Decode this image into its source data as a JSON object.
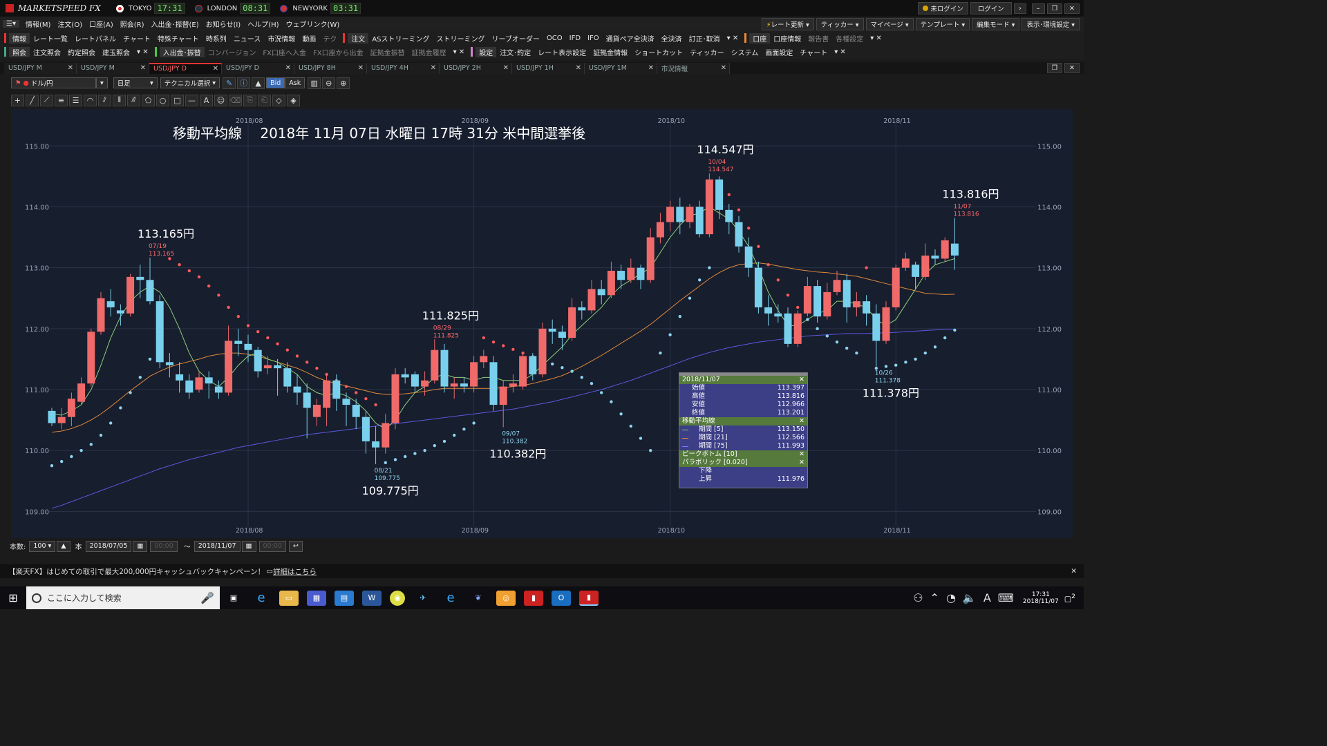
{
  "app": {
    "logo_text": "MARKETSPEED FX",
    "clocks": [
      {
        "city": "TOKYO",
        "time": "17:31",
        "color": "#d11"
      },
      {
        "city": "LONDON",
        "time": "08:31",
        "color": "#345"
      },
      {
        "city": "NEWYORK",
        "time": "03:31",
        "color": "#246"
      }
    ],
    "login_status": "未ログイン",
    "login_button": "ログイン"
  },
  "menu": [
    "情報(M)",
    "注文(O)",
    "口座(A)",
    "照会(R)",
    "入出金･振替(E)",
    "お知らせ(I)",
    "ヘルプ(H)",
    "ウェブリンク(W)"
  ],
  "toolbar1": {
    "group_info": "情報",
    "info_items": [
      "レート一覧",
      "レートパネル",
      "チャート",
      "特殊チャート",
      "時系列",
      "ニュース",
      "市況情報",
      "動画",
      "テク"
    ],
    "group_order": "注文",
    "order_items": [
      "ASストリーミング",
      "ストリーミング",
      "リーブオーダー",
      "OCO",
      "IFD",
      "IFO",
      "通貨ペア全決済",
      "全決済",
      "訂正･取消"
    ],
    "group_account": "口座",
    "account_items": [
      "口座情報",
      "報告書",
      "各種設定"
    ]
  },
  "toolbar_right": [
    "レート更新",
    "ティッカー",
    "マイページ",
    "テンプレート",
    "編集モード",
    "表示･環境設定"
  ],
  "toolbar2": {
    "group_query": "照会",
    "query_items": [
      "注文照会",
      "約定照会",
      "建玉照会"
    ],
    "group_fund": "入出金･振替",
    "fund_items": [
      "コンバージョン",
      "FX口座へ入金",
      "FX口座から出金",
      "証拠金振替",
      "証拠金履歴"
    ],
    "group_settings": "設定",
    "settings_items": [
      "注文･約定",
      "レート表示設定",
      "証拠金情報",
      "ショートカット",
      "ティッカー",
      "システム",
      "画面設定",
      "チャート"
    ]
  },
  "tabs": [
    "USD/JPY M",
    "USD/JPY M",
    "USD/JPY D",
    "USD/JPY D",
    "USD/JPY 8H",
    "USD/JPY 4H",
    "USD/JPY 2H",
    "USD/JPY 1H",
    "USD/JPY 1M",
    "市況情報"
  ],
  "active_tab": 2,
  "controls": {
    "currency": "ドル/円",
    "period": "日足",
    "technical": "テクニカル選択",
    "bid": "Bid",
    "ask": "Ask"
  },
  "chart_title": "移動平均線　 2018年 11月 07日 水曜日 17時 31分 米中間選挙後",
  "chart_data": {
    "type": "candlestick",
    "y_range": [
      108.8,
      115.4
    ],
    "y_ticks": [
      "115.00",
      "114.00",
      "113.00",
      "112.00",
      "111.00",
      "110.00",
      "109.00"
    ],
    "x_month_labels": [
      {
        "label": "2018/08",
        "index": 20
      },
      {
        "label": "2018/09",
        "index": 43
      },
      {
        "label": "2018/10",
        "index": 63
      },
      {
        "label": "2018/11",
        "index": 86
      }
    ],
    "candles": [
      [
        110.65,
        110.45,
        110.7,
        110.4
      ],
      [
        110.45,
        110.55,
        110.7,
        110.35
      ],
      [
        110.55,
        110.85,
        110.95,
        110.4
      ],
      [
        110.8,
        111.1,
        111.2,
        110.75
      ],
      [
        111.1,
        111.95,
        112.0,
        111.05
      ],
      [
        111.95,
        112.5,
        112.6,
        111.9
      ],
      [
        112.45,
        112.35,
        112.65,
        112.2
      ],
      [
        112.3,
        112.25,
        112.4,
        112.05
      ],
      [
        112.25,
        112.85,
        112.9,
        112.2
      ],
      [
        112.85,
        112.8,
        113.05,
        112.5
      ],
      [
        112.8,
        112.45,
        113.165,
        112.4
      ],
      [
        112.45,
        111.45,
        112.55,
        111.35
      ],
      [
        111.45,
        111.4,
        111.6,
        111.2
      ],
      [
        111.25,
        111.15,
        111.45,
        110.95
      ],
      [
        111.15,
        110.95,
        111.25,
        110.85
      ],
      [
        111.0,
        111.2,
        111.3,
        110.95
      ],
      [
        111.2,
        111.1,
        111.3,
        110.85
      ],
      [
        111.05,
        110.95,
        111.15,
        110.85
      ],
      [
        110.95,
        111.8,
        112.05,
        110.9
      ],
      [
        111.8,
        111.75,
        112.0,
        111.55
      ],
      [
        111.75,
        111.65,
        111.9,
        111.45
      ],
      [
        111.65,
        111.3,
        111.7,
        111.2
      ],
      [
        111.35,
        111.4,
        111.55,
        111.25
      ],
      [
        111.4,
        111.35,
        111.5,
        110.9
      ],
      [
        111.35,
        111.05,
        111.45,
        110.95
      ],
      [
        111.05,
        110.95,
        111.25,
        110.75
      ],
      [
        110.95,
        110.7,
        111.1,
        110.2
      ],
      [
        110.55,
        110.75,
        110.85,
        110.4
      ],
      [
        110.7,
        111.15,
        111.25,
        110.4
      ],
      [
        111.15,
        110.85,
        111.25,
        110.65
      ],
      [
        110.85,
        110.75,
        110.95,
        110.4
      ],
      [
        110.75,
        110.55,
        110.85,
        110.35
      ],
      [
        110.55,
        110.15,
        110.65,
        109.95
      ],
      [
        110.15,
        110.05,
        110.4,
        109.775
      ],
      [
        110.05,
        110.45,
        110.6,
        109.95
      ],
      [
        110.45,
        111.25,
        111.35,
        110.35
      ],
      [
        111.25,
        111.2,
        111.35,
        111.1
      ],
      [
        111.25,
        111.05,
        111.3,
        110.95
      ],
      [
        111.05,
        111.15,
        111.3,
        110.9
      ],
      [
        111.15,
        111.65,
        111.825,
        111.1
      ],
      [
        111.65,
        111.05,
        111.75,
        110.95
      ],
      [
        111.05,
        111.1,
        111.2,
        110.85
      ],
      [
        111.1,
        111.05,
        111.2,
        110.95
      ],
      [
        111.05,
        111.45,
        111.55,
        110.95
      ],
      [
        111.45,
        111.55,
        111.65,
        111.35
      ],
      [
        111.45,
        110.75,
        111.55,
        110.65
      ],
      [
        110.75,
        111.05,
        111.15,
        110.382
      ],
      [
        111.05,
        111.1,
        111.25,
        110.95
      ],
      [
        111.05,
        111.55,
        111.6,
        111.0
      ],
      [
        111.55,
        111.25,
        111.6,
        111.15
      ],
      [
        111.25,
        112.0,
        112.1,
        111.2
      ],
      [
        112.0,
        111.95,
        112.15,
        111.75
      ],
      [
        111.95,
        111.85,
        112.05,
        111.65
      ],
      [
        111.85,
        112.35,
        112.5,
        111.8
      ],
      [
        112.35,
        112.3,
        112.45,
        112.15
      ],
      [
        112.3,
        112.65,
        112.8,
        112.25
      ],
      [
        112.65,
        112.55,
        112.8,
        112.4
      ],
      [
        112.55,
        112.95,
        113.1,
        112.5
      ],
      [
        112.95,
        112.8,
        113.05,
        112.65
      ],
      [
        112.8,
        113.0,
        113.15,
        112.75
      ],
      [
        113.0,
        112.8,
        113.05,
        112.65
      ],
      [
        112.8,
        113.5,
        113.65,
        112.75
      ],
      [
        113.5,
        113.75,
        113.9,
        113.4
      ],
      [
        113.75,
        114.0,
        114.1,
        113.6
      ],
      [
        114.0,
        113.75,
        114.15,
        113.55
      ],
      [
        113.75,
        114.0,
        114.05,
        113.65
      ],
      [
        114.0,
        113.55,
        114.1,
        113.5
      ],
      [
        113.55,
        114.45,
        114.547,
        113.5
      ],
      [
        114.45,
        113.95,
        114.5,
        113.8
      ],
      [
        113.95,
        113.75,
        114.05,
        113.55
      ],
      [
        113.75,
        113.35,
        113.85,
        113.25
      ],
      [
        113.35,
        113.0,
        113.5,
        112.85
      ],
      [
        113.0,
        112.35,
        113.1,
        112.25
      ],
      [
        112.35,
        112.25,
        112.55,
        112.05
      ],
      [
        112.25,
        112.2,
        112.4,
        112.1
      ],
      [
        112.25,
        111.75,
        112.35,
        111.7
      ],
      [
        111.75,
        112.25,
        112.3,
        111.7
      ],
      [
        112.25,
        112.7,
        112.85,
        112.2
      ],
      [
        112.7,
        112.2,
        112.8,
        112.1
      ],
      [
        112.2,
        112.6,
        112.75,
        112.15
      ],
      [
        112.6,
        112.8,
        112.95,
        112.55
      ],
      [
        112.8,
        112.35,
        112.9,
        112.1
      ],
      [
        112.35,
        112.45,
        112.6,
        112.2
      ],
      [
        112.45,
        112.25,
        112.55,
        112.05
      ],
      [
        112.25,
        111.8,
        112.4,
        111.378
      ],
      [
        111.8,
        112.35,
        112.45,
        111.75
      ],
      [
        112.35,
        113.0,
        113.05,
        112.3
      ],
      [
        113.0,
        113.15,
        113.25,
        112.95
      ],
      [
        113.05,
        112.85,
        113.1,
        112.65
      ],
      [
        112.85,
        113.2,
        113.4,
        112.8
      ],
      [
        113.2,
        113.15,
        113.3,
        113.05
      ],
      [
        113.15,
        113.45,
        113.5,
        113.1
      ],
      [
        113.397,
        113.201,
        113.816,
        112.966
      ]
    ],
    "ma5": [
      110.6,
      110.58,
      110.65,
      110.75,
      111.0,
      111.4,
      111.85,
      112.2,
      112.45,
      112.6,
      112.7,
      112.6,
      112.35,
      112.0,
      111.6,
      111.3,
      111.15,
      111.05,
      111.2,
      111.4,
      111.55,
      111.6,
      111.5,
      111.45,
      111.35,
      111.25,
      111.05,
      110.95,
      110.9,
      110.95,
      110.9,
      110.8,
      110.65,
      110.45,
      110.35,
      110.5,
      110.75,
      110.95,
      111.05,
      111.2,
      111.25,
      111.2,
      111.2,
      111.15,
      111.2,
      111.2,
      111.15,
      111.15,
      111.15,
      111.25,
      111.4,
      111.55,
      111.7,
      111.9,
      112.05,
      112.2,
      112.35,
      112.55,
      112.7,
      112.8,
      112.9,
      113.0,
      113.25,
      113.5,
      113.7,
      113.85,
      113.9,
      114.0,
      113.9,
      113.8,
      113.6,
      113.35,
      113.0,
      112.6,
      112.3,
      112.05,
      112.05,
      112.15,
      112.25,
      112.3,
      112.45,
      112.45,
      112.4,
      112.35,
      112.15,
      112.05,
      112.15,
      112.4,
      112.65,
      112.9,
      113.05,
      113.1,
      113.15
    ],
    "ma21": [
      110.3,
      110.32,
      110.36,
      110.42,
      110.5,
      110.6,
      110.72,
      110.85,
      110.98,
      111.1,
      111.22,
      111.3,
      111.37,
      111.42,
      111.46,
      111.5,
      111.55,
      111.58,
      111.6,
      111.6,
      111.58,
      111.55,
      111.5,
      111.45,
      111.4,
      111.35,
      111.28,
      111.2,
      111.14,
      111.1,
      111.06,
      111.02,
      110.98,
      110.94,
      110.92,
      110.92,
      110.93,
      110.95,
      110.97,
      111.0,
      111.02,
      111.02,
      111.02,
      111.02,
      111.02,
      111.02,
      111.03,
      111.05,
      111.07,
      111.1,
      111.14,
      111.18,
      111.23,
      111.3,
      111.38,
      111.47,
      111.56,
      111.66,
      111.76,
      111.86,
      111.96,
      112.07,
      112.2,
      112.33,
      112.46,
      112.58,
      112.7,
      112.82,
      112.92,
      113.0,
      113.05,
      113.07,
      113.08,
      113.06,
      113.03,
      113.0,
      112.97,
      112.95,
      112.93,
      112.92,
      112.9,
      112.88,
      112.86,
      112.82,
      112.78,
      112.74,
      112.7,
      112.66,
      112.62,
      112.58,
      112.57,
      112.56,
      112.566
    ],
    "ma75": [
      109.05,
      109.1,
      109.16,
      109.22,
      109.28,
      109.34,
      109.4,
      109.46,
      109.52,
      109.58,
      109.64,
      109.7,
      109.75,
      109.8,
      109.85,
      109.89,
      109.93,
      109.97,
      110.01,
      110.05,
      110.08,
      110.11,
      110.14,
      110.17,
      110.2,
      110.23,
      110.26,
      110.28,
      110.3,
      110.32,
      110.34,
      110.36,
      110.38,
      110.4,
      110.42,
      110.44,
      110.46,
      110.48,
      110.5,
      110.52,
      110.54,
      110.56,
      110.58,
      110.6,
      110.62,
      110.64,
      110.66,
      110.68,
      110.71,
      110.74,
      110.77,
      110.8,
      110.84,
      110.88,
      110.92,
      110.96,
      111.0,
      111.05,
      111.1,
      111.15,
      111.21,
      111.27,
      111.33,
      111.39,
      111.45,
      111.51,
      111.56,
      111.61,
      111.65,
      111.69,
      111.72,
      111.75,
      111.78,
      111.8,
      111.82,
      111.84,
      111.86,
      111.88,
      111.89,
      111.9,
      111.91,
      111.92,
      111.92,
      111.92,
      111.93,
      111.93,
      111.94,
      111.95,
      111.96,
      111.97,
      111.98,
      111.99,
      111.993
    ],
    "sar": [
      109.75,
      109.82,
      109.9,
      110.0,
      110.1,
      110.25,
      110.45,
      110.7,
      110.95,
      111.2,
      111.5,
      111.8,
      113.15,
      113.05,
      112.95,
      112.85,
      112.7,
      112.55,
      112.35,
      112.2,
      112.05,
      111.95,
      111.85,
      111.75,
      111.65,
      111.55,
      111.45,
      111.35,
      111.25,
      111.15,
      111.05,
      110.95,
      110.85,
      110.75,
      109.8,
      109.85,
      109.9,
      109.95,
      110.0,
      110.08,
      110.15,
      110.25,
      110.35,
      110.45,
      111.85,
      111.78,
      111.72,
      111.66,
      111.6,
      111.54,
      111.48,
      111.42,
      111.36,
      111.3,
      111.2,
      111.1,
      110.95,
      110.8,
      110.6,
      110.4,
      110.2,
      110.0,
      111.6,
      111.9,
      112.2,
      112.5,
      112.8,
      113.0,
      114.4,
      114.2,
      113.95,
      113.65,
      113.35,
      113.05,
      112.8,
      112.55,
      112.35,
      112.15,
      112.0,
      111.88,
      111.78,
      111.68,
      111.6,
      113.0,
      111.35,
      111.38,
      111.4,
      111.45,
      111.5,
      111.6,
      111.7,
      111.85,
      111.976
    ],
    "peaks": [
      {
        "index": 10,
        "date": "07/19",
        "value": "113.165",
        "big": "113.165円",
        "pos": "top"
      },
      {
        "index": 33,
        "date": "08/21",
        "value": "109.775",
        "big": "109.775円",
        "pos": "bottom"
      },
      {
        "index": 39,
        "date": "08/29",
        "value": "111.825",
        "big": "111.825円",
        "pos": "top"
      },
      {
        "index": 46,
        "date": "09/07",
        "value": "110.382",
        "big": "110.382円",
        "pos": "bottom"
      },
      {
        "index": 67,
        "date": "10/04",
        "value": "114.547",
        "big": "114.547円",
        "pos": "top"
      },
      {
        "index": 84,
        "date": "10/26",
        "value": "111.378",
        "big": "111.378円",
        "pos": "bottom"
      },
      {
        "index": 92,
        "date": "11/07",
        "value": "113.816",
        "big": "113.816円",
        "pos": "top"
      }
    ],
    "colors": {
      "up": "#f06a6a",
      "down": "#79d0ec",
      "ma5": "#8fd07a",
      "ma21": "#e08a3a",
      "ma75": "#5a5ae0",
      "sar": "#ff5a5a",
      "sar_up": "#8fd4f0"
    }
  },
  "popup": {
    "date": "2018/11/07",
    "ohlc": [
      [
        "始値",
        "113.397"
      ],
      [
        "高値",
        "113.816"
      ],
      [
        "安値",
        "112.966"
      ],
      [
        "終値",
        "113.201"
      ]
    ],
    "ma_title": "移動平均線",
    "ma": [
      [
        "期間 [5]",
        "113.150"
      ],
      [
        "期間 [21]",
        "112.566"
      ],
      [
        "期間 [75]",
        "111.993"
      ]
    ],
    "peak_title": "ピークボトム [10]",
    "sar_title": "パラボリック [0.020]",
    "sar": [
      [
        "下降",
        ""
      ],
      [
        "上昇",
        "111.976"
      ]
    ]
  },
  "bottom": {
    "count_label": "本数:",
    "count_value": "100",
    "unit": "本",
    "from": "2018/07/05",
    "time1": "00:00",
    "tilde": "〜",
    "to": "2018/11/07",
    "time2": "00:00"
  },
  "banner": {
    "text": "【楽天FX】はじめての取引で最大200,000円キャッシュバックキャンペーン！",
    "link": "詳細はこちら"
  },
  "taskbar": {
    "search_placeholder": "ここに入力して検索",
    "time": "17:31",
    "date": "2018/11/07",
    "notifications": "2"
  }
}
